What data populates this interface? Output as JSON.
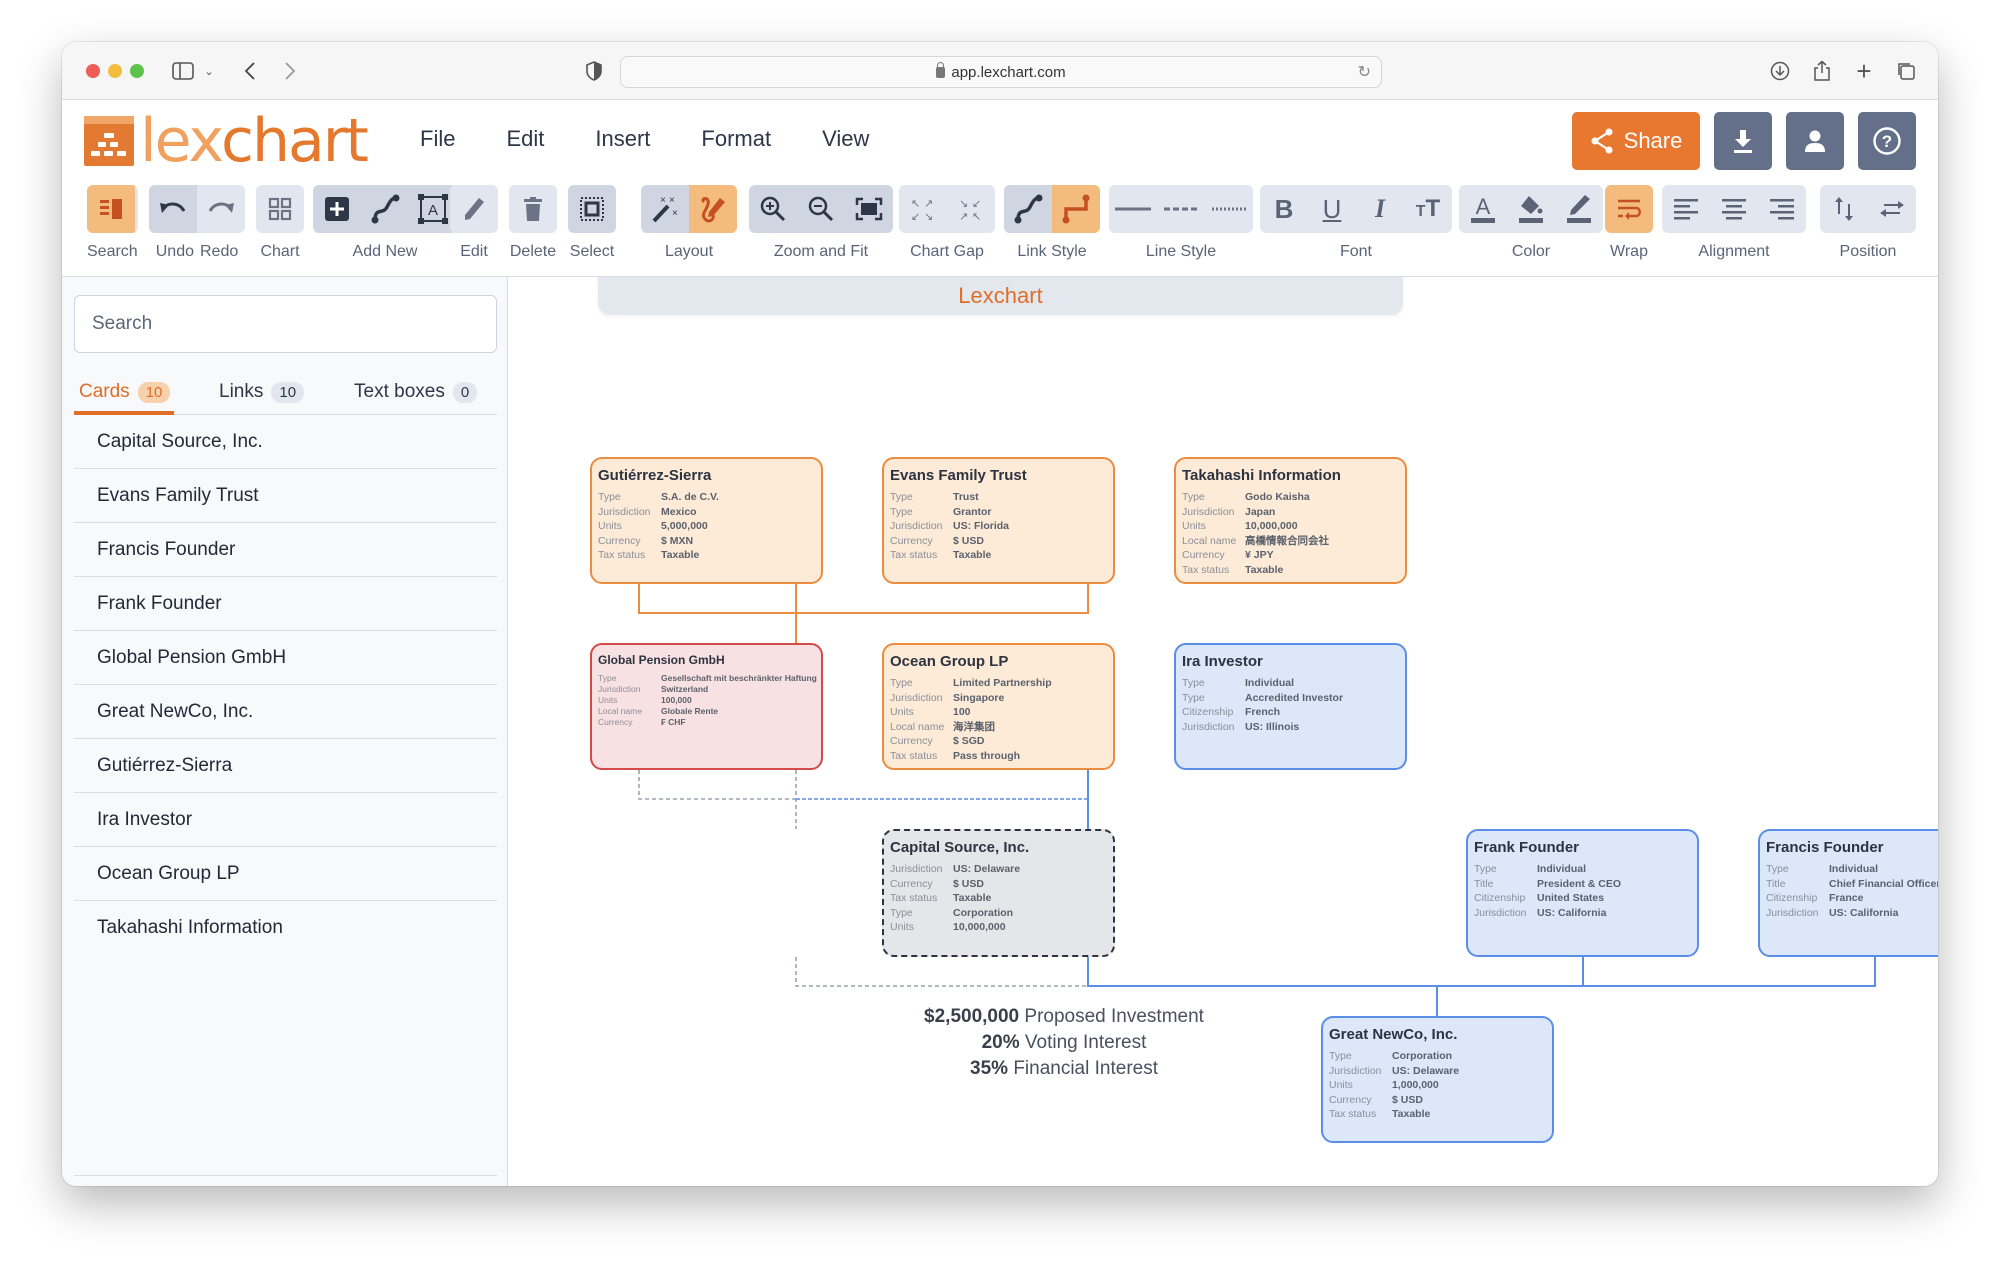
{
  "browser": {
    "url": "app.lexchart.com",
    "icons": [
      "sidebar-toggle-icon",
      "chevron-down-icon",
      "back-icon",
      "forward-icon",
      "shield-icon",
      "lock-icon",
      "reload-icon",
      "download-icon",
      "share-icon",
      "new-tab-icon",
      "tabs-overview-icon"
    ]
  },
  "app": {
    "logo_text_light": "lex",
    "logo_text_dark": "chart",
    "menu": [
      "File",
      "Edit",
      "Insert",
      "Format",
      "View"
    ],
    "share_label": "Share",
    "header_icons": [
      "download-icon",
      "user-icon",
      "help-icon"
    ],
    "colors": {
      "accent": "#e8782f",
      "slate": "#64708a",
      "card_orange": "#fdebd7",
      "card_red": "#f8e1e2",
      "card_blue": "#dce7fa",
      "card_gray": "#e4e6ea"
    }
  },
  "toolbar": {
    "groups": [
      {
        "label": "Search"
      },
      {
        "label": "Undo"
      },
      {
        "label": "Redo"
      },
      {
        "label": "Chart"
      },
      {
        "label": "Add New"
      },
      {
        "label": "Edit"
      },
      {
        "label": "Delete"
      },
      {
        "label": "Select"
      },
      {
        "label": "Layout"
      },
      {
        "label": "Zoom and Fit"
      },
      {
        "label": "Chart Gap"
      },
      {
        "label": "Link Style"
      },
      {
        "label": "Line Style"
      },
      {
        "label": "Font"
      },
      {
        "label": "Color"
      },
      {
        "label": "Wrap"
      },
      {
        "label": "Alignment"
      },
      {
        "label": "Position"
      }
    ]
  },
  "sidebar": {
    "search_placeholder": "Search",
    "tabs": [
      {
        "label": "Cards",
        "count": "10"
      },
      {
        "label": "Links",
        "count": "10"
      },
      {
        "label": "Text boxes",
        "count": "0"
      }
    ],
    "items": [
      "Capital Source, Inc.",
      "Evans Family Trust",
      "Francis Founder",
      "Frank Founder",
      "Global Pension GmbH",
      "Great NewCo, Inc.",
      "Gutiérrez-Sierra",
      "Ira Investor",
      "Ocean Group LP",
      "Takahashi Information"
    ]
  },
  "canvas": {
    "title": "Lexchart",
    "cards": {
      "gutierrez": {
        "title": "Gutiérrez-Sierra",
        "rows": [
          [
            "Type",
            "S.A. de C.V."
          ],
          [
            "Jurisdiction",
            "Mexico"
          ],
          [
            "Units",
            "5,000,000"
          ],
          [
            "Currency",
            "$ MXN"
          ],
          [
            "Tax status",
            "Taxable"
          ]
        ]
      },
      "evans": {
        "title": "Evans Family Trust",
        "rows": [
          [
            "Type",
            "Trust"
          ],
          [
            "Type",
            "Grantor"
          ],
          [
            "Jurisdiction",
            "US: Florida"
          ],
          [
            "Currency",
            "$ USD"
          ],
          [
            "Tax status",
            "Taxable"
          ]
        ]
      },
      "takahashi": {
        "title": "Takahashi Information",
        "rows": [
          [
            "Type",
            "Godo Kaisha"
          ],
          [
            "Jurisdiction",
            "Japan"
          ],
          [
            "Units",
            "10,000,000"
          ],
          [
            "Local name",
            "高橋情報合同会社"
          ],
          [
            "Currency",
            "¥ JPY"
          ],
          [
            "Tax status",
            "Taxable"
          ]
        ]
      },
      "global": {
        "title": "Global Pension GmbH",
        "rows": [
          [
            "Type",
            "Gesellschaft mit beschränkter Haftung"
          ],
          [
            "Jurisdiction",
            "Switzerland"
          ],
          [
            "Units",
            "100,000"
          ],
          [
            "Local name",
            "Globale Rente"
          ],
          [
            "Currency",
            "₣ CHF"
          ]
        ]
      },
      "ocean": {
        "title": "Ocean Group LP",
        "rows": [
          [
            "Type",
            "Limited Partnership"
          ],
          [
            "Jurisdiction",
            "Singapore"
          ],
          [
            "Units",
            "100"
          ],
          [
            "Local name",
            "海洋集团"
          ],
          [
            "Currency",
            "$ SGD"
          ],
          [
            "Tax status",
            "Pass through"
          ]
        ]
      },
      "ira": {
        "title": "Ira Investor",
        "rows": [
          [
            "Type",
            "Individual"
          ],
          [
            "Type",
            "Accredited Investor"
          ],
          [
            "Citizenship",
            "French"
          ],
          [
            "Jurisdiction",
            "US: Illinois"
          ]
        ]
      },
      "capital": {
        "title": "Capital Source, Inc.",
        "rows": [
          [
            "Jurisdiction",
            "US: Delaware"
          ],
          [
            "Currency",
            "$ USD"
          ],
          [
            "Tax status",
            "Taxable"
          ],
          [
            "Type",
            "Corporation"
          ],
          [
            "Units",
            "10,000,000"
          ]
        ]
      },
      "frank": {
        "title": "Frank Founder",
        "rows": [
          [
            "Type",
            "Individual"
          ],
          [
            "Title",
            "President & CEO"
          ],
          [
            "Citizenship",
            "United States"
          ],
          [
            "Jurisdiction",
            "US: California"
          ]
        ]
      },
      "francis": {
        "title": "Francis Founder",
        "rows": [
          [
            "Type",
            "Individual"
          ],
          [
            "Title",
            "Chief Financial Officer"
          ],
          [
            "Citizenship",
            "France"
          ],
          [
            "Jurisdiction",
            "US: California"
          ]
        ]
      },
      "newco": {
        "title": "Great NewCo, Inc.",
        "rows": [
          [
            "Type",
            "Corporation"
          ],
          [
            "Jurisdiction",
            "US: Delaware"
          ],
          [
            "Units",
            "1,000,000"
          ],
          [
            "Currency",
            "$ USD"
          ],
          [
            "Tax status",
            "Taxable"
          ]
        ]
      }
    },
    "investment": {
      "amount": "$2,500,000",
      "amount_label": "Proposed Investment",
      "voting": "20%",
      "voting_label": "Voting Interest",
      "financial": "35%",
      "financial_label": "Financial Interest"
    }
  }
}
